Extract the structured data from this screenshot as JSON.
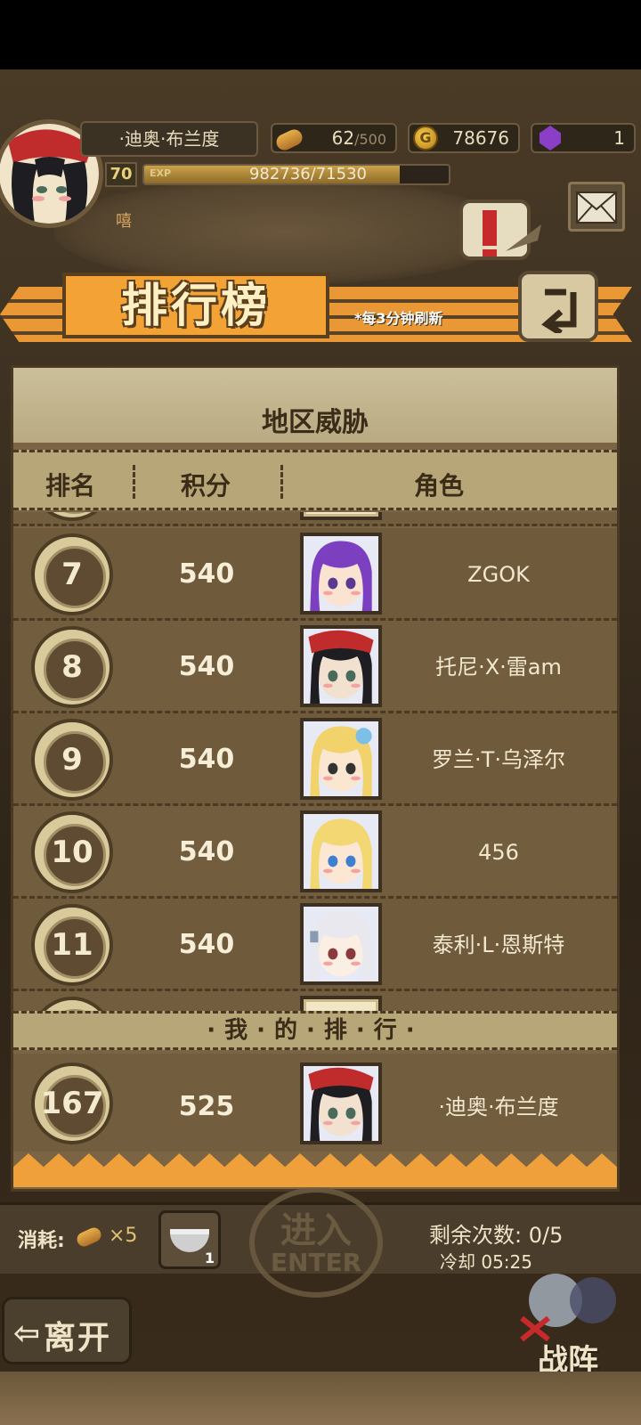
{
  "hud": {
    "player_name": "·迪奥·布兰度",
    "level": "70",
    "exp_label": "EXP",
    "exp_text": "982736/71530",
    "exp_fraction": 0.84,
    "status": "嘻",
    "bread": "62",
    "bread_max": "/500",
    "gold_symbol": "G",
    "gold": "78676",
    "gems": "1"
  },
  "banner": {
    "title": "排行榜",
    "note": "*每3分钟刷新"
  },
  "panel": {
    "title": "地区威胁",
    "headers": {
      "rank": "排名",
      "score": "积分",
      "role": "角色"
    },
    "rows": [
      {
        "rank": "7",
        "score": "540",
        "name": "ZGOK",
        "portrait": "purple-hair-girl"
      },
      {
        "rank": "8",
        "score": "540",
        "name": "托尼·X·雷am",
        "portrait": "red-bandana-black-hair"
      },
      {
        "rank": "9",
        "score": "540",
        "name": "罗兰·T·乌泽尔",
        "portrait": "blonde-squint-girl"
      },
      {
        "rank": "10",
        "score": "540",
        "name": "456",
        "portrait": "blonde-blue-eyes-girl"
      },
      {
        "rank": "11",
        "score": "540",
        "name": "泰利·L·恩斯特",
        "portrait": "silver-hair-girl"
      }
    ],
    "my_rank_header": "·我·的·排·行·",
    "my_rank": {
      "rank": "167",
      "score": "525",
      "name": "·迪奥·布兰度",
      "portrait": "red-bandana-black-hair"
    }
  },
  "bottom": {
    "cost_label": "消耗:",
    "cost_qty": "×5",
    "item_count": "1",
    "enter_cn": "进入",
    "enter_en": "ENTER",
    "remaining": "剩余次数: 0/5",
    "cooldown": "冷却 05:25",
    "leave": "离开",
    "formation": "战阵"
  },
  "colors": {
    "accent_orange": "#f29d36",
    "panel_brown": "#725d3e",
    "parchment": "#cbbf9a"
  }
}
